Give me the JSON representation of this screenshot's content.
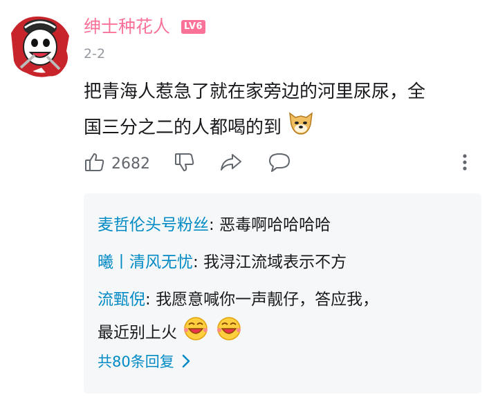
{
  "comment": {
    "username": "绅士种花人",
    "level": "LV6",
    "date": "2-2",
    "text_line1": "把青海人惹急了就在家旁边的河里尿尿，全",
    "text_line2": "国三分之二的人都喝的到",
    "like_count": "2682"
  },
  "replies": [
    {
      "name": "麦哲伦头号粉丝",
      "sep": ": ",
      "text": "恶毒啊哈哈哈哈"
    },
    {
      "name": "曦丨清风无忧",
      "sep": ": ",
      "text": "我浔江流域表示不方"
    },
    {
      "name": "流甄倪",
      "sep": ": ",
      "text": "我愿意喊你一声靓仔，答应我，",
      "text2": "最近别上火"
    }
  ],
  "more_replies": "共80条回复",
  "colors": {
    "accent": "#fb7299",
    "link": "#008ac5",
    "muted": "#9499a0"
  },
  "icons": [
    "avatar",
    "doge-emoji",
    "thumbs-up-icon",
    "thumbs-down-icon",
    "share-icon",
    "comment-icon",
    "more-vertical-icon",
    "laugh-emoji",
    "chevron-right-icon"
  ]
}
